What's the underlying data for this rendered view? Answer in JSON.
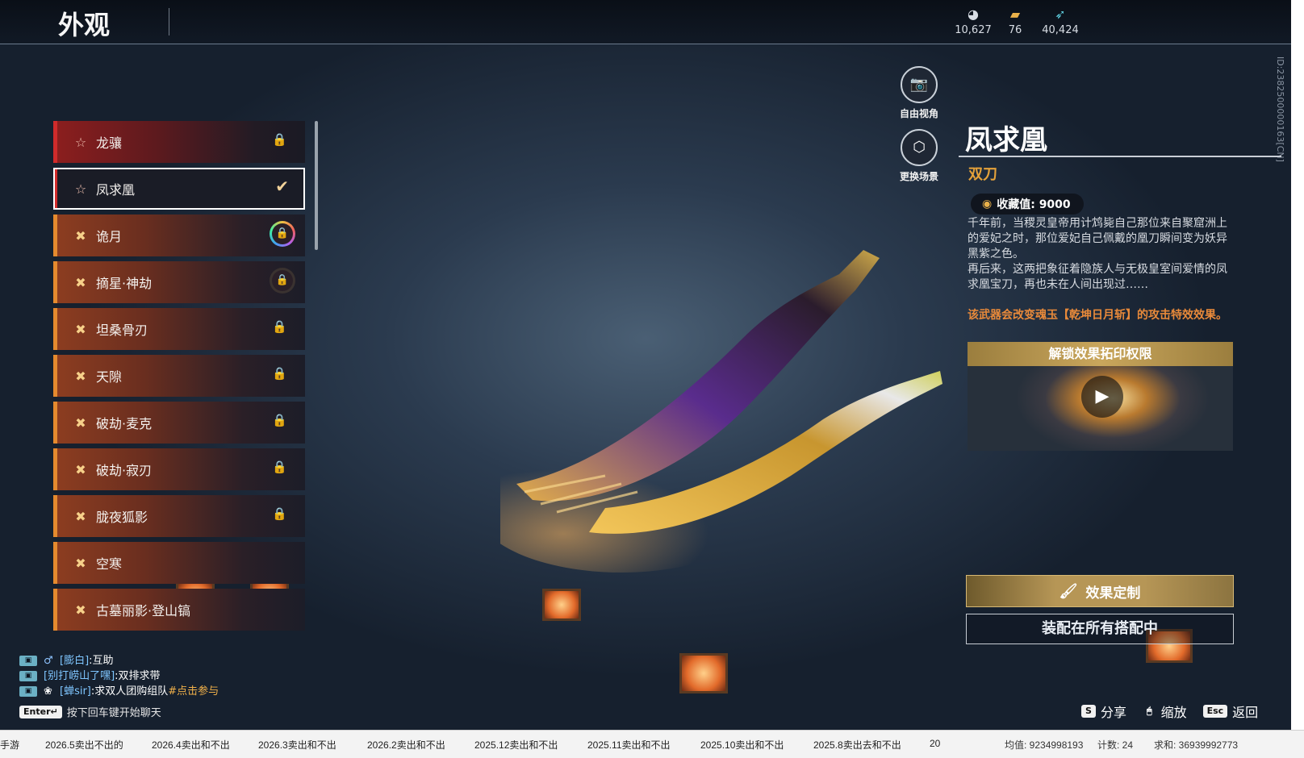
{
  "header": {
    "title": "外观",
    "currencies": [
      {
        "icon": "coin-icon",
        "value": "10,627"
      },
      {
        "icon": "ticket-icon",
        "value": "76"
      },
      {
        "icon": "feather-icon",
        "value": "40,424"
      }
    ]
  },
  "side_id": "ID:2382500000163[CN]",
  "camera": {
    "free_view": "自由视角",
    "change_scene": "更换场景"
  },
  "skins": [
    {
      "name": "龙骧",
      "rarity": "red",
      "status": "locked"
    },
    {
      "name": "凤求凰",
      "rarity": "red",
      "status": "selected"
    },
    {
      "name": "诡月",
      "rarity": "orange",
      "status": "ring-locked"
    },
    {
      "name": "摘星·神劫",
      "rarity": "orange",
      "status": "dark-locked"
    },
    {
      "name": "坦桑骨刃",
      "rarity": "orange",
      "status": "locked"
    },
    {
      "name": "天隙",
      "rarity": "orange",
      "status": "locked"
    },
    {
      "name": "破劫·麦克",
      "rarity": "orange",
      "status": "locked"
    },
    {
      "name": "破劫·寂刃",
      "rarity": "orange",
      "status": "locked"
    },
    {
      "name": "胧夜狐影",
      "rarity": "orange",
      "status": "locked"
    },
    {
      "name": "空寒",
      "rarity": "orange",
      "status": "none"
    },
    {
      "name": "古墓丽影·登山镐",
      "rarity": "orange",
      "status": "none"
    }
  ],
  "weapon": {
    "name": "凤求凰",
    "type": "双刀",
    "collect_label": "收藏值: 9000",
    "description": [
      "千年前，当稷灵皇帝用计鸩毙自己那位来自聚窟洲上的爱妃之时，那位爱妃自己佩戴的凰刀瞬间变为妖异黑紫之色。",
      "再后来，这两把象征着隐族人与无极皇室间爱情的凤求凰宝刀，再也未在人间出现过……"
    ],
    "note": "该武器会改变魂玉【乾坤日月斩】的攻击特效效果。",
    "unlock_title": "解锁效果拓印权限",
    "customize_label": "效果定制",
    "equip_label": "装配在所有搭配中"
  },
  "chat": {
    "lines": [
      {
        "name": "[膨白]",
        "msg": ":互助",
        "link": ""
      },
      {
        "name": "[别打崂山了嘿]",
        "msg": ":双排求带",
        "link": ""
      },
      {
        "name": "[蝉sir]",
        "msg": ":求双人团购组队",
        "link": "#点击参与"
      }
    ],
    "enter_key": "Enter↵",
    "hint": "按下回车键开始聊天"
  },
  "hotkeys": [
    {
      "key": "S",
      "label": "分享"
    },
    {
      "key": "🖱",
      "label": "缩放"
    },
    {
      "key": "Esc",
      "label": "返回"
    }
  ],
  "sheet": {
    "tabs": [
      "手游",
      "2026.5卖出不出的",
      "2026.4卖出和不出",
      "2026.3卖出和不出",
      "2026.2卖出和不出",
      "2025.12卖出和不出",
      "2025.11卖出和不出",
      "2025.10卖出和不出",
      "2025.8卖出去和不出",
      "20"
    ],
    "avg": "均值: 9234998193",
    "count": "计数: 24",
    "sum": "求和: 36939992773"
  },
  "colors": {
    "accent_gold": "#e5a23a",
    "note_orange": "#e98a3a",
    "red_rarity": "#d02b2b",
    "orange_rarity": "#e58a2e"
  }
}
